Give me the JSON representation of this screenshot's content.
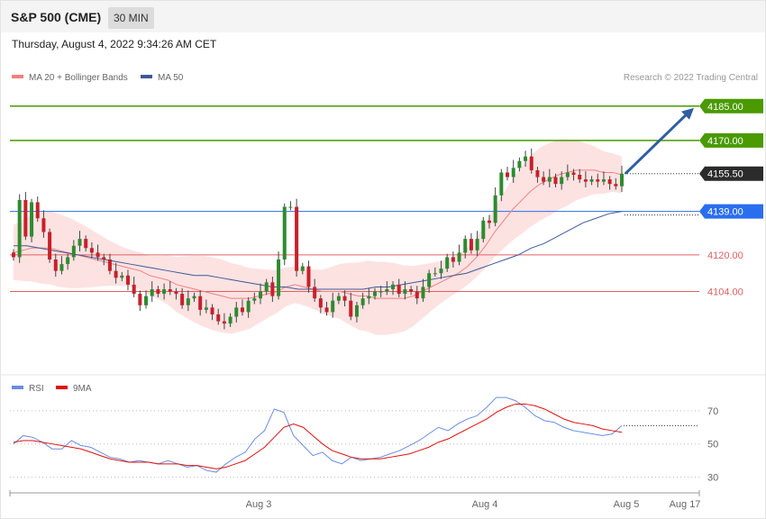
{
  "header": {
    "symbol": "S&P 500 (CME)",
    "timeframe": "30 MIN",
    "timestamp": "Thursday, August 4, 2022 9:34:26 AM CET"
  },
  "legend": {
    "ma20": "MA 20 + Bollinger Bands",
    "ma50": "MA 50",
    "rsi": "RSI",
    "ma9": "9MA"
  },
  "credit": "Research © 2022 Trading Central",
  "colors": {
    "up": "#2e8b2e",
    "down": "#c8202a",
    "band": "#fde2e2",
    "ma20": "#f08080",
    "ma50": "#3c5a99",
    "rsi": "#6a8de0",
    "rsi_ma": "#e01010",
    "resistance": "#4a9a00",
    "pivot": "#2a6ef0",
    "support": "#e06060"
  },
  "chart_data": [
    {
      "type": "candlestick",
      "y_range": [
        4068,
        4192
      ],
      "x_labels": [
        "Aug 3",
        "Aug 4",
        "Aug 5",
        "Aug 17"
      ],
      "levels": [
        {
          "value": 4185.0,
          "label": "4185.00",
          "kind": "resistance"
        },
        {
          "value": 4170.0,
          "label": "4170.00",
          "kind": "resistance"
        },
        {
          "value": 4155.5,
          "label": "4155.50",
          "kind": "last"
        },
        {
          "value": 4139.0,
          "label": "4139.00",
          "kind": "pivot"
        },
        {
          "value": 4120.0,
          "label": "4120.00",
          "kind": "support"
        },
        {
          "value": 4104.0,
          "label": "4104.00",
          "kind": "support"
        }
      ],
      "closes": [
        4119,
        4144,
        4128,
        4143,
        4136,
        4130,
        4118,
        4113,
        4116,
        4119,
        4124,
        4127,
        4123,
        4121,
        4119,
        4118,
        4113,
        4110,
        4111,
        4107,
        4103,
        4098,
        4102,
        4105,
        4103,
        4105,
        4104,
        4103,
        4098,
        4101,
        4102,
        4096,
        4097,
        4094,
        4091,
        4090,
        4093,
        4097,
        4095,
        4100,
        4101,
        4104,
        4108,
        4102,
        4118,
        4141,
        4141,
        4113,
        4115,
        4106,
        4101,
        4097,
        4095,
        4100,
        4102,
        4100,
        4093,
        4098,
        4101,
        4102,
        4104,
        4104,
        4105,
        4107,
        4103,
        4105,
        4104,
        4101,
        4106,
        4112,
        4112,
        4114,
        4119,
        4117,
        4121,
        4127,
        4122,
        4127,
        4135,
        4134,
        4146,
        4156,
        4154,
        4158,
        4161,
        4163,
        4157,
        4154,
        4152,
        4154,
        4151,
        4154,
        4156,
        4155,
        4153,
        4152,
        4153,
        4152,
        4153,
        4151,
        4150,
        4155.5
      ],
      "ma20": [
        4121,
        4122,
        4123,
        4123,
        4123,
        4122,
        4121,
        4120,
        4119,
        4118,
        4117,
        4116,
        4115,
        4114,
        4113,
        4111,
        4110,
        4109,
        4107,
        4106,
        4105,
        4104,
        4103,
        4102,
        4101,
        4101,
        4101,
        4102,
        4103,
        4104,
        4106,
        4107,
        4106,
        4105,
        4104,
        4104,
        4104,
        4103,
        4102,
        4102,
        4101,
        4101,
        4101,
        4101,
        4102,
        4104,
        4106,
        4108,
        4110,
        4112,
        4115,
        4119,
        4124,
        4130,
        4135,
        4140,
        4144,
        4148,
        4151,
        4153,
        4155,
        4156,
        4157,
        4157,
        4157,
        4156,
        4156,
        4155
      ],
      "ma50": [
        4124,
        4124,
        4123,
        4122,
        4121,
        4120,
        4119,
        4118,
        4117,
        4116,
        4115,
        4114,
        4113,
        4112,
        4111,
        4111,
        4110,
        4109,
        4108,
        4107,
        4106,
        4106,
        4105,
        4105,
        4105,
        4105,
        4105,
        4105,
        4106,
        4106,
        4107,
        4108,
        4109,
        4110,
        4111,
        4112,
        4114,
        4116,
        4118,
        4120,
        4123,
        4125,
        4128,
        4131,
        4134,
        4136,
        4138,
        4139
      ]
    },
    {
      "type": "line",
      "y_range": [
        20,
        84
      ],
      "y_ticks": [
        70,
        50,
        30
      ],
      "series": [
        {
          "name": "RSI",
          "values": [
            50,
            55,
            54,
            51,
            47,
            47,
            52,
            49,
            48,
            45,
            42,
            41,
            39,
            40,
            39,
            38,
            40,
            38,
            36,
            37,
            34,
            33,
            38,
            42,
            45,
            53,
            58,
            71,
            69,
            55,
            49,
            43,
            45,
            40,
            38,
            42,
            40,
            41,
            42,
            44,
            46,
            49,
            52,
            56,
            60,
            58,
            62,
            65,
            67,
            72,
            78,
            78,
            76,
            72,
            67,
            64,
            63,
            60,
            58,
            57,
            56,
            55,
            56,
            61
          ]
        },
        {
          "name": "9MA",
          "values": [
            51,
            52,
            52,
            51,
            50,
            49,
            48,
            47,
            45,
            43,
            41,
            40,
            39,
            39,
            39,
            38,
            38,
            38,
            37,
            37,
            36,
            35,
            36,
            38,
            40,
            44,
            48,
            54,
            60,
            62,
            60,
            55,
            50,
            46,
            44,
            42,
            41,
            41,
            41,
            42,
            43,
            44,
            46,
            48,
            51,
            53,
            56,
            59,
            62,
            65,
            69,
            72,
            74,
            74,
            73,
            71,
            68,
            65,
            63,
            62,
            61,
            59,
            58,
            57
          ]
        }
      ]
    }
  ]
}
